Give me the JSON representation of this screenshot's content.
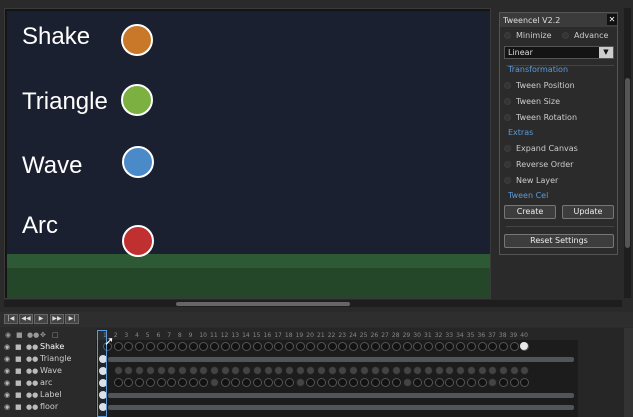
{
  "canvas": {
    "rows": [
      {
        "label": "Shake",
        "ball_color": "#c87828"
      },
      {
        "label": "Triangle",
        "ball_color": "#7cb040"
      },
      {
        "label": "Wave",
        "ball_color": "#4a8ac8"
      },
      {
        "label": "Arc",
        "ball_color": "#c03030"
      }
    ]
  },
  "panel": {
    "title": "Tweencel V2.2",
    "close": "✕",
    "minimize": "Minimize",
    "advance": "Advance",
    "easing": "Linear",
    "section_transformation": "Transformation",
    "tween_position": "Tween Position",
    "tween_size": "Tween Size",
    "tween_rotation": "Tween Rotation",
    "section_extras": "Extras",
    "expand_canvas": "Expand Canvas",
    "reverse_order": "Reverse Order",
    "new_layer": "New Layer",
    "section_tween_cel": "Tween Cel",
    "create": "Create",
    "update": "Update",
    "reset": "Reset Settings"
  },
  "timeline": {
    "controls": [
      "|◀",
      "◀◀",
      "▶",
      "▶▶",
      "▶|"
    ],
    "frame_count": 40,
    "layers": [
      {
        "name": "Shake"
      },
      {
        "name": "Triangle"
      },
      {
        "name": "Wave"
      },
      {
        "name": "arc"
      },
      {
        "name": "Label"
      },
      {
        "name": "floor"
      }
    ]
  },
  "icons": {
    "eye": "eye-icon",
    "lock": "lock-icon",
    "link": "link-icon",
    "cursor": "mouse-cursor-icon"
  }
}
